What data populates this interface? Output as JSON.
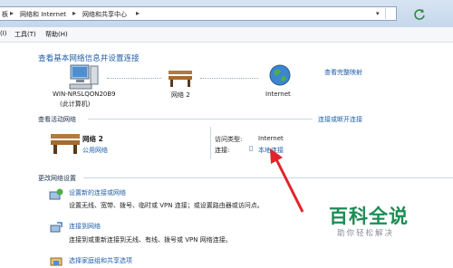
{
  "addressbar": {
    "crumbs": [
      "网络和 Internet",
      "网络和共享中心"
    ],
    "left_fragment": "板"
  },
  "menubar": {
    "items": [
      "(I)",
      "工具(T)",
      "帮助(H)"
    ]
  },
  "main": {
    "heading": "查看基本网络信息并设置连接",
    "full_map_link": "查看完整映射",
    "map": {
      "computer_name": "WIN-NRSLQON20B9",
      "computer_sub": "(此计算机)",
      "network_label": "网络 2",
      "internet_label": "Internet"
    },
    "active_section": {
      "title": "查看活动网络",
      "connect_link": "连接或断开连接",
      "network_name": "网络 2",
      "network_type": "公用网络",
      "access_type_label": "访问类型:",
      "access_type_value": "Internet",
      "connections_label": "连接:",
      "connections_value": "本地连接"
    },
    "change_section": {
      "title": "更改网络设置",
      "tasks": [
        {
          "title": "设置新的连接或网络",
          "desc": "设置无线、宽带、拨号、临时或 VPN 连接；或设置路由器或访问点。"
        },
        {
          "title": "连接到网络",
          "desc": "连接到或重新连接到无线、有线、拨号或 VPN 网络连接。"
        },
        {
          "title": "选择家庭组和共享选项",
          "desc": ""
        }
      ]
    }
  },
  "watermark": {
    "main": "百科全说",
    "sub": "助你轻松解决"
  },
  "colors": {
    "link": "#1f5fa8",
    "arrow": "#e0242a",
    "watermark": "#1c8c55"
  }
}
